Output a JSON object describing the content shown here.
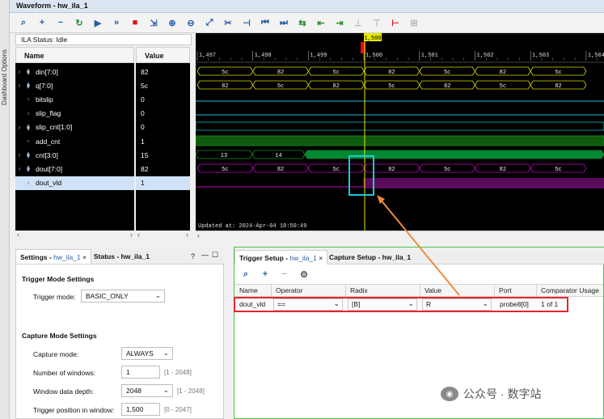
{
  "dashboard_tab": "Dashboard Options",
  "window_title": "Waveform - hw_ila_1",
  "toolbar_icons": [
    "search-icon",
    "plus-icon",
    "minus-icon",
    "refresh-icon",
    "play-icon",
    "fast-forward-icon",
    "stop-icon",
    "export-icon",
    "zoom-in-icon",
    "zoom-out-icon",
    "zoom-fit-icon",
    "cursor-icon",
    "marker-icon",
    "go-first-icon",
    "go-last-icon",
    "add-marker-icon",
    "prev-marker-icon",
    "next-marker-icon",
    "prev-edge-icon",
    "next-edge-icon",
    "swap-icon",
    "measure-icon"
  ],
  "ila_status": "ILA Status: Idle",
  "headers": {
    "name": "Name",
    "value": "Value"
  },
  "signals": [
    {
      "name": "din[7:0]",
      "value": "82",
      "bus": true
    },
    {
      "name": "q[7:0]",
      "value": "5c",
      "bus": true
    },
    {
      "name": "bitslip",
      "value": "0",
      "bus": false
    },
    {
      "name": "slip_flag",
      "value": "0",
      "bus": false
    },
    {
      "name": "slip_cnt[1:0]",
      "value": "0",
      "bus": true
    },
    {
      "name": "add_cnt",
      "value": "1",
      "bus": false
    },
    {
      "name": "cnt[3:0]",
      "value": "15",
      "bus": true
    },
    {
      "name": "dout[7:0]",
      "value": "82",
      "bus": true
    },
    {
      "name": "dout_vld",
      "value": "1",
      "bus": false
    }
  ],
  "wave": {
    "time_labels": [
      "1,497",
      "1,498",
      "1,499",
      "1,500",
      "1,501",
      "1,502",
      "1,503",
      "1,504"
    ],
    "cursor_label": "1,500",
    "din_values": [
      "5c",
      "82",
      "5c",
      "82",
      "5c",
      "82",
      "5c"
    ],
    "q_values": [
      "82",
      "5c",
      "82",
      "5c",
      "82",
      "5c",
      "82"
    ],
    "cnt_values": [
      "13",
      "14"
    ],
    "dout_values": [
      "5c",
      "82",
      "5c",
      "82",
      "5c",
      "82",
      "5c"
    ],
    "updated": "Updated at: 2024-Apr-04 18:50:49",
    "colors": {
      "bus": "#d8d800",
      "slip": "#1ebcd0",
      "green": "#1d8a1d",
      "magenta": "#c000c0",
      "cursor": "#e8e800"
    }
  },
  "settings_panel": {
    "tab_settings": "Settings - ",
    "tab_settings_link": "hw_ila_1",
    "tab_status": "Status - hw_ila_1",
    "help": "?",
    "trigger_mode_section": "Trigger Mode Settings",
    "trigger_mode_label": "Trigger mode:",
    "trigger_mode_value": "BASIC_ONLY",
    "capture_section": "Capture Mode Settings",
    "capture_mode_label": "Capture mode:",
    "capture_mode_value": "ALWAYS",
    "windows_label": "Number of windows:",
    "windows_value": "1",
    "windows_range": "[1 - 2048]",
    "depth_label": "Window data depth:",
    "depth_value": "2048",
    "depth_range": "[1 - 2048]",
    "position_label": "Trigger position in window:",
    "position_value": "1,500",
    "position_range": "[0 - 2047]"
  },
  "trigger_panel": {
    "tab_trigger": "Trigger Setup - ",
    "tab_trigger_link": "hw_ila_1",
    "tab_capture": "Capture Setup - hw_ila_1",
    "columns": [
      "Name",
      "Operator",
      "Radix",
      "Value",
      "Port",
      "Comparator Usage"
    ],
    "row": {
      "name": "dout_vld",
      "operator": "==",
      "radix": "[B]",
      "value": "R",
      "port": "probe8[0]",
      "usage": "1 of 1"
    }
  },
  "watermark": "公众号 · 数字站"
}
